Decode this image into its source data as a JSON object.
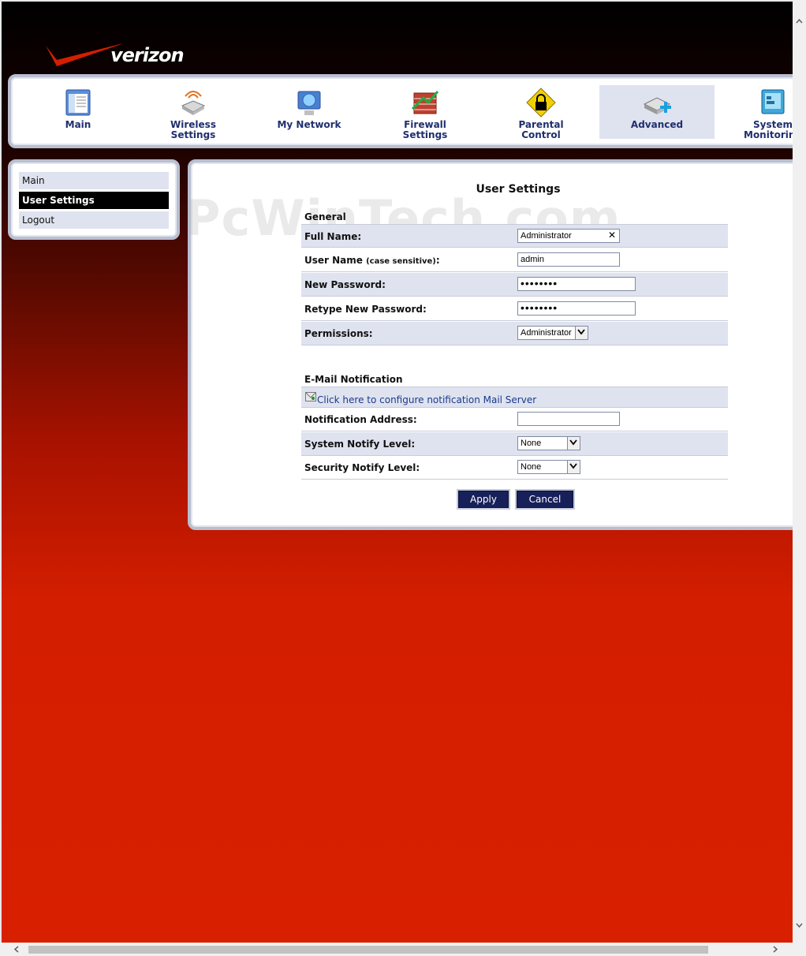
{
  "brand": {
    "logo_text": "verizon",
    "logo_color": "#d41e00"
  },
  "topnav": {
    "items": [
      {
        "label": "Main",
        "icon": "main-window-icon"
      },
      {
        "label": "Wireless\nSettings",
        "icon": "wireless-router-icon"
      },
      {
        "label": "My Network",
        "icon": "network-computer-icon"
      },
      {
        "label": "Firewall\nSettings",
        "icon": "firewall-icon"
      },
      {
        "label": "Parental\nControl",
        "icon": "padlock-icon"
      },
      {
        "label": "Advanced",
        "icon": "advanced-router-icon",
        "active": true
      },
      {
        "label": "System\nMonitoring",
        "icon": "monitor-icon"
      }
    ]
  },
  "sidemenu": {
    "items": [
      {
        "label": "Main"
      },
      {
        "label": "User Settings",
        "active": true
      },
      {
        "label": "Logout"
      }
    ]
  },
  "watermark": "PcWinTech.com",
  "form": {
    "title": "User Settings",
    "general": {
      "heading": "General",
      "full_name_label": "Full Name:",
      "full_name_value": "Administrator",
      "clear_glyph": "✕",
      "user_name_label": "User Name",
      "user_name_note": "(case sensitive)",
      "user_name_colon": ":",
      "user_name_value": "admin",
      "new_password_label": "New Password:",
      "new_password_value": "••••••••",
      "retype_password_label": "Retype New Password:",
      "retype_password_value": "••••••••",
      "permissions_label": "Permissions:",
      "permissions_value": "Administrator"
    },
    "email": {
      "heading": "E-Mail Notification",
      "mail_server_link": "Click here to configure notification Mail Server",
      "notification_address_label": "Notification Address:",
      "notification_address_value": "",
      "system_notify_label": "System Notify Level:",
      "system_notify_value": "None",
      "security_notify_label": "Security Notify Level:",
      "security_notify_value": "None"
    },
    "apply_label": "Apply",
    "cancel_label": "Cancel"
  },
  "colors": {
    "nav_text": "#1f2f6e",
    "button_bg": "#18205a",
    "row_shade": "#dfe3ef",
    "panel_border": "#b9bfd0"
  }
}
